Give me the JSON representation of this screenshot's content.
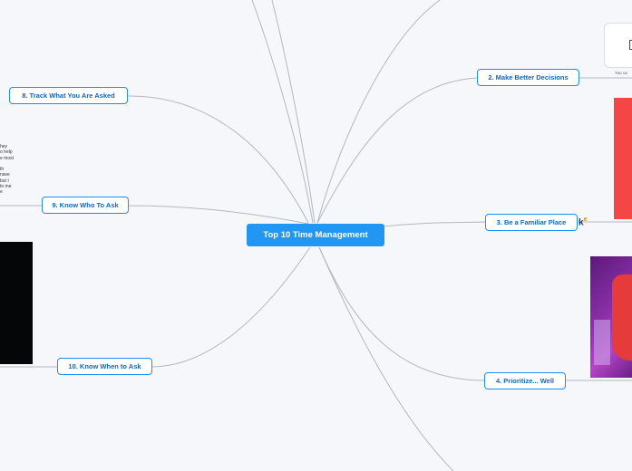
{
  "map": {
    "root": "Top 10 Time Management",
    "topics": [
      {
        "id": "t2",
        "label": "2. Make Better Decisions"
      },
      {
        "id": "t3",
        "label": "3. Be a Familiar Place"
      },
      {
        "id": "t4",
        "label": "4. Prioritize... Well"
      },
      {
        "id": "t8",
        "label": "8. Track What You Are Asked"
      },
      {
        "id": "t9",
        "label": "9. Know Who To Ask"
      },
      {
        "id": "t10",
        "label": "10. Know When to Ask"
      }
    ]
  },
  "fragments": {
    "left_note": "hey\no help\ne most\n\nth\nnave\nbut I\nto me\ne",
    "card_caption": "You ca",
    "logo_text": "k",
    "logo_mark": "e"
  },
  "colors": {
    "connector": "#b5b7bd",
    "topic_border": "#1f8ff0",
    "root_fill": "#2196f3",
    "background": "#f6f7fb"
  }
}
